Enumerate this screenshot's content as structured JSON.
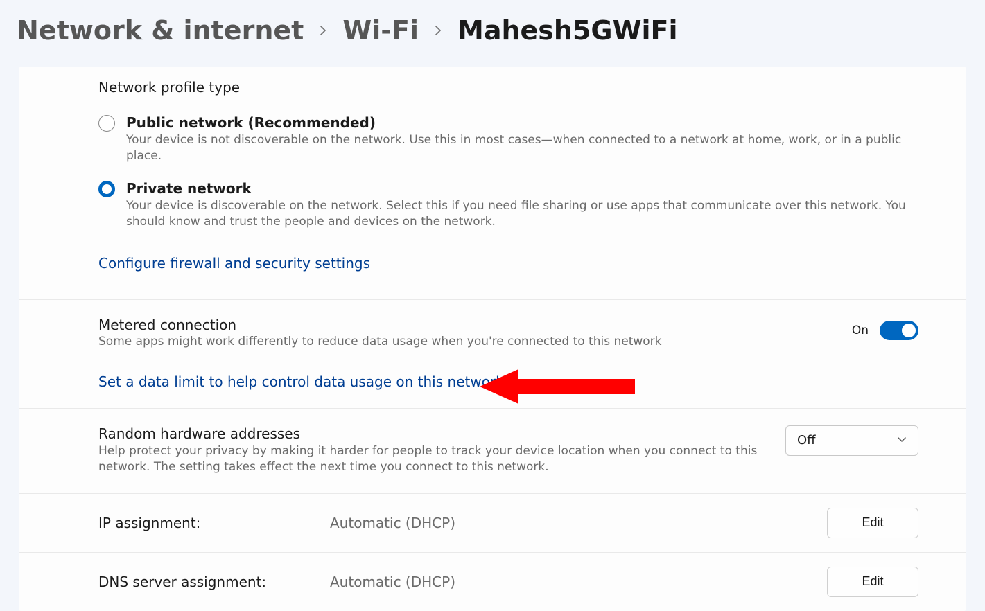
{
  "breadcrumb": {
    "root": "Network & internet",
    "mid": "Wi-Fi",
    "current": "Mahesh5GWiFi"
  },
  "profile": {
    "heading": "Network profile type",
    "options": [
      {
        "title": "Public network (Recommended)",
        "desc": "Your device is not discoverable on the network. Use this in most cases—when connected to a network at home, work, or in a public place.",
        "selected": false
      },
      {
        "title": "Private network",
        "desc": "Your device is discoverable on the network. Select this if you need file sharing or use apps that communicate over this network. You should know and trust the people and devices on the network.",
        "selected": true
      }
    ],
    "firewall_link": "Configure firewall and security settings"
  },
  "metered": {
    "title": "Metered connection",
    "desc": "Some apps might work differently to reduce data usage when you're connected to this network",
    "toggle_state_label": "On",
    "toggle_on": true,
    "data_limit_link": "Set a data limit to help control data usage on this network"
  },
  "hardware": {
    "title": "Random hardware addresses",
    "desc": "Help protect your privacy by making it harder for people to track your device location when you connect to this network. The setting takes effect the next time you connect to this network.",
    "dropdown_value": "Off"
  },
  "ip": {
    "label": "IP assignment:",
    "value": "Automatic (DHCP)",
    "button": "Edit"
  },
  "dns": {
    "label": "DNS server assignment:",
    "value": "Automatic (DHCP)",
    "button": "Edit"
  }
}
